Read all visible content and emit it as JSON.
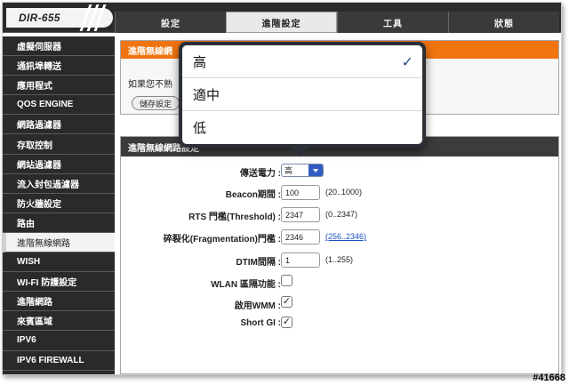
{
  "app": {
    "logo": "DIR-655"
  },
  "tabs": [
    {
      "label": "設定"
    },
    {
      "label": "進階設定"
    },
    {
      "label": "工具"
    },
    {
      "label": "狀態"
    }
  ],
  "sidebar": {
    "items": [
      {
        "label": "虛擬伺服器"
      },
      {
        "label": "通訊埠轉送"
      },
      {
        "label": "應用程式"
      },
      {
        "label": "QOS ENGINE"
      },
      {
        "label": "網路過濾器"
      },
      {
        "label": "存取控制"
      },
      {
        "label": "網站過濾器"
      },
      {
        "label": "流入封包過濾器"
      },
      {
        "label": "防火牆設定"
      },
      {
        "label": "路由"
      },
      {
        "label": "進階無線網路"
      },
      {
        "label": "WISH"
      },
      {
        "label": "WI-FI 防護設定"
      },
      {
        "label": "進階網路"
      },
      {
        "label": "來賓區域"
      },
      {
        "label": "IPV6"
      },
      {
        "label": "IPV6 FIREWALL"
      }
    ],
    "active_index": 10
  },
  "intro": {
    "title": "進階無線網",
    "text": "如果您不熟",
    "save_label": "儲存設定"
  },
  "settings": {
    "title": "進階無線網路設定",
    "rows": [
      {
        "label": "傳送電力 :",
        "type": "select",
        "value": "高"
      },
      {
        "label": "Beacon期間 :",
        "type": "text",
        "value": "100",
        "hint": "(20..1000)"
      },
      {
        "label": "RTS 門檻(Threshold) :",
        "type": "text",
        "value": "2347",
        "hint": "(0..2347)"
      },
      {
        "label": "碎裂化(Fragmentation)門檻 :",
        "type": "text",
        "value": "2346",
        "hint_link": "(256..2346)"
      },
      {
        "label": "DTIM間隔 :",
        "type": "text",
        "value": "1",
        "hint": "(1..255)"
      },
      {
        "label": "WLAN 區隔功能 :",
        "type": "checkbox",
        "checked": false
      },
      {
        "label": "啟用WMM :",
        "type": "checkbox",
        "checked": true
      },
      {
        "label": "Short GI :",
        "type": "checkbox",
        "checked": true
      }
    ]
  },
  "popover": {
    "options": [
      {
        "label": "高",
        "selected": true
      },
      {
        "label": "適中",
        "selected": false
      },
      {
        "label": "低",
        "selected": false
      }
    ],
    "check_glyph": "✓"
  },
  "watermark": "#41668",
  "colors": {
    "accent": "#f07410",
    "dark": "#2a2a2a",
    "select_arrow": "#2f5cc0",
    "link": "#1a4fc4"
  }
}
